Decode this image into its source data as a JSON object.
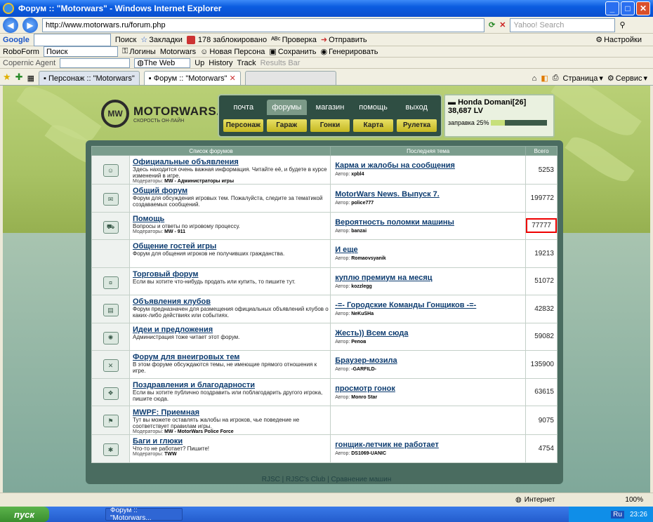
{
  "window": {
    "title": "Форум :: \"Motorwars\" - Windows Internet Explorer"
  },
  "addressbar": {
    "url": "http://www.motorwars.ru/forum.php",
    "search_placeholder": "Yahoo! Search"
  },
  "google_bar": {
    "brand": "Google",
    "search": "Поиск",
    "bookmarks": "Закладки",
    "blocked": "178 заблокировано",
    "check": "Проверка",
    "send": "Отправить",
    "settings": "Настройки"
  },
  "roboform_bar": {
    "brand": "RoboForm",
    "search": "Поиск",
    "logins": "Логины",
    "motorwars": "Motorwars",
    "new_persona": "Новая Персона",
    "save": "Сохранить",
    "generate": "Генерировать"
  },
  "copernic_bar": {
    "brand": "Copernic Agent",
    "scope": "The Web",
    "up": "Up",
    "history": "History",
    "track": "Track",
    "results": "Results Bar"
  },
  "tabs": [
    "Персонаж :: \"Motorwars\"",
    "Форум :: \"Motorwars\""
  ],
  "ie_tools": {
    "page": "Страница",
    "service": "Сервис"
  },
  "site": {
    "logo_mark": "MW",
    "logo_name": "MOTORWARS.RU",
    "logo_tag": "СКОРОСТЬ ОН-ЛАЙН",
    "menu_top": [
      "почта",
      "форумы",
      "магазин",
      "помощь",
      "выход"
    ],
    "menu_bottom": [
      "Персонаж",
      "Гараж",
      "Гонки",
      "Карта",
      "Рулетка"
    ],
    "player_name": "Honda Domani[26]",
    "player_money": "38,687 LV",
    "fuel_label": "заправка 25%",
    "fuel_percent": 25
  },
  "forum": {
    "headers": [
      "Список форумов",
      "Последняя тема",
      "Всего"
    ],
    "rows": [
      {
        "icon": "person-icon",
        "title": "Официальные объявления",
        "desc": "Здесь находится очень важная информация. Читайте её, и будете в курсе изменений в игре.",
        "mod_label": "Модераторы:",
        "mod": "MW - Администраторы игры",
        "last": "Карма и жалобы на сообщения",
        "author_label": "Автор:",
        "author": "xpbl4",
        "total": "5253"
      },
      {
        "icon": "chat-icon",
        "title": "Общий форум",
        "desc": "Форум для обсуждения игровых тем. Пожалуйста, следите за тематикой создаваемых сообщений.",
        "mod_label": "",
        "mod": "",
        "last": "MotorWars News. Выпуск 7.",
        "author_label": "Автор:",
        "author": "police777",
        "total": "199772"
      },
      {
        "icon": "truck-icon",
        "title": "Помощь",
        "desc": "Вопросы и ответы по игровому процессу.",
        "mod_label": "Модераторы:",
        "mod": "MW - 911",
        "last": "Вероятность поломки машины",
        "author_label": "Автор:",
        "author": "banzai",
        "total": "77777"
      },
      {
        "icon": "",
        "title": "Общение гостей игры",
        "desc": "Форум для общения игроков не получивших гражданства.",
        "mod_label": "",
        "mod": "",
        "last": "И еще",
        "author_label": "Автор:",
        "author": "Romaovsyanik",
        "total": "19213"
      },
      {
        "icon": "money-icon",
        "title": "Торговый форум",
        "desc": "Если вы хотите что-нибудь продать или купить, то пишите тут.",
        "mod_label": "",
        "mod": "",
        "last": "куплю премиум на месяц",
        "author_label": "Автор:",
        "author": "kozzlegg",
        "total": "51072"
      },
      {
        "icon": "clubs-icon",
        "title": "Объявления клубов",
        "desc": "Форум предназначен для размещения официальных объявлений клубов о каких-либо действиях или событиях.",
        "mod_label": "",
        "mod": "",
        "last": "-=- Городские Команды Гонщиков -=-",
        "author_label": "Автор:",
        "author": "NeKuSHa",
        "total": "42832"
      },
      {
        "icon": "lightbulb-icon",
        "title": "Идеи и предложения",
        "desc": "Администрация тоже читает этот форум.",
        "mod_label": "",
        "mod": "",
        "last": "Жесть)) Всем сюда",
        "author_label": "Автор:",
        "author": "Репов",
        "total": "59082"
      },
      {
        "icon": "cross-icon",
        "title": "Форум для внеигровых тем",
        "desc": "В этом форуме обсуждаются темы, не имеющие прямого отношения к игре.",
        "mod_label": "",
        "mod": "",
        "last": "Браузер-мозила",
        "author_label": "Автор:",
        "author": "-GARFILD-",
        "total": "135900"
      },
      {
        "icon": "gift-icon",
        "title": "Поздравления и благодарности",
        "desc": "Если вы хотите публично поздравить или поблагодарить другого игрока, пишите сюда.",
        "mod_label": "",
        "mod": "",
        "last": "просмотр гонок",
        "author_label": "Автор:",
        "author": "Monro Star",
        "total": "63615"
      },
      {
        "icon": "police-car-icon",
        "title": "MWPF: Приемная",
        "desc": "Тут вы можете оставлять жалобы на игроков, чье поведение не соответствует правилам игры.",
        "mod_label": "Модераторы:",
        "mod": "MW - MotorWars Police Force",
        "last": "",
        "author_label": "",
        "author": "",
        "total": "9075"
      },
      {
        "icon": "bug-icon",
        "title": "Баги и глюки",
        "desc": "Что-то не работает? Пишите!",
        "mod_label": "Модераторы:",
        "mod": "TWW",
        "last": "гонщик-летчик не работает",
        "author_label": "Автор:",
        "author": "DS1069-UANIC",
        "total": "4754"
      }
    ]
  },
  "footer": {
    "links": "RJSC | RJSC's Club | Сравнение машин"
  },
  "status": {
    "zone": "Интернет",
    "zoom": "100%"
  },
  "taskbar": {
    "start": "пуск",
    "task": "Форум :: \"Motorwars...",
    "lang": "Ru",
    "clock": "23:26"
  }
}
